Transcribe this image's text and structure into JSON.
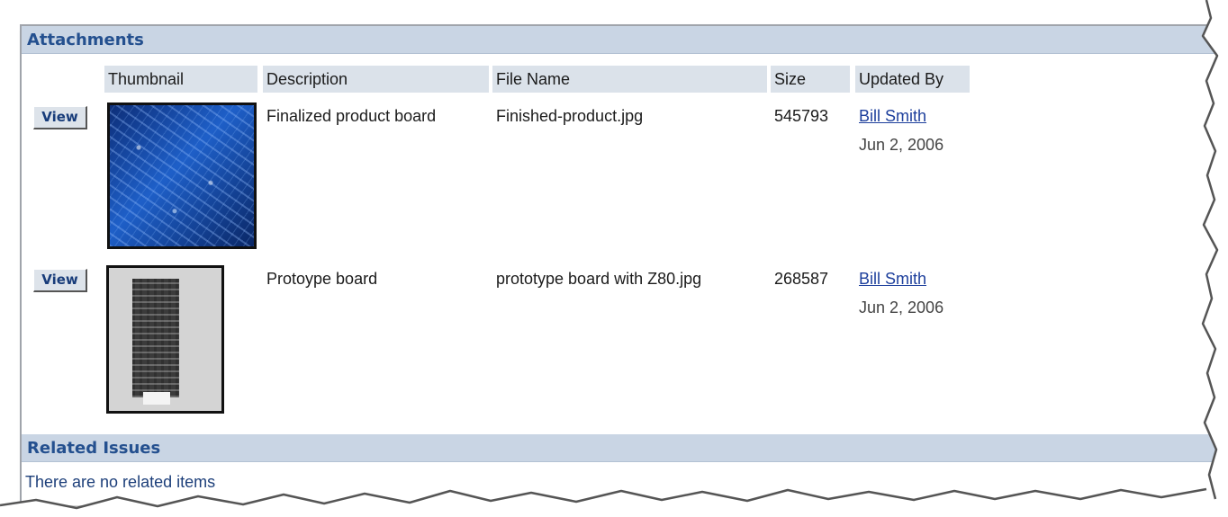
{
  "attachments": {
    "title": "Attachments",
    "columns": [
      "Thumbnail",
      "Description",
      "File Name",
      "Size",
      "Updated By"
    ],
    "rows": [
      {
        "view_label": "View",
        "thumbnail": "circuit-board-blue",
        "description": "Finalized product board",
        "file_name": "Finished-product.jpg",
        "size": "545793",
        "updated_by": "Bill Smith",
        "date": "Jun 2, 2006"
      },
      {
        "view_label": "View",
        "thumbnail": "prototype-board-grayscale",
        "description": "Protoype board",
        "file_name": "prototype board with Z80.jpg",
        "size": "268587",
        "updated_by": "Bill Smith",
        "date": "Jun 2, 2006"
      }
    ]
  },
  "related_issues": {
    "title": "Related Issues",
    "empty_text": "There are no related items"
  },
  "colors": {
    "header_bg": "#c9d5e4",
    "header_text": "#24508f",
    "column_header_bg": "#dbe2ea",
    "link": "#1d3f9c"
  }
}
